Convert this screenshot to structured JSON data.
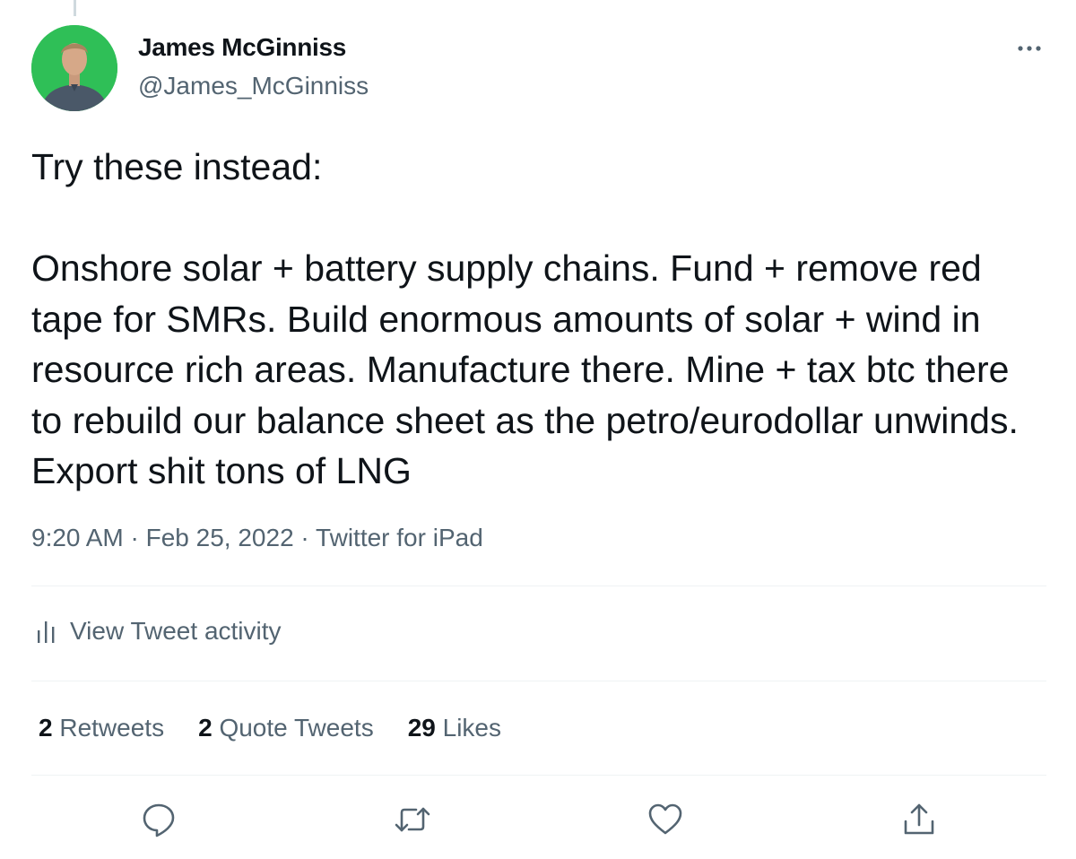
{
  "author": {
    "name": "James McGinniss",
    "handle": "@James_McGinniss"
  },
  "tweet": {
    "text": "Try these instead:\n\nOnshore solar + battery supply chains. Fund + remove red tape for SMRs. Build enormous amounts of solar + wind in resource rich areas. Manufacture there. Mine + tax btc there to rebuild our balance sheet as the petro/eurodollar unwinds. Export shit tons of LNG",
    "time": "9:20 AM",
    "date": "Feb 25, 2022",
    "source": "Twitter for iPad",
    "separator": " · "
  },
  "activity": {
    "label": "View Tweet activity"
  },
  "stats": {
    "retweets_count": "2",
    "retweets_label": "Retweets",
    "quotes_count": "2",
    "quotes_label": "Quote Tweets",
    "likes_count": "29",
    "likes_label": "Likes"
  },
  "icons": {
    "more": "more-horizontal-icon",
    "activity": "bar-chart-icon",
    "reply": "reply-icon",
    "retweet": "retweet-icon",
    "like": "heart-icon",
    "share": "share-icon"
  },
  "colors": {
    "text": "#0f1419",
    "secondary": "#536471",
    "divider": "#eff3f4",
    "avatar_bg": "#2fbf57"
  }
}
